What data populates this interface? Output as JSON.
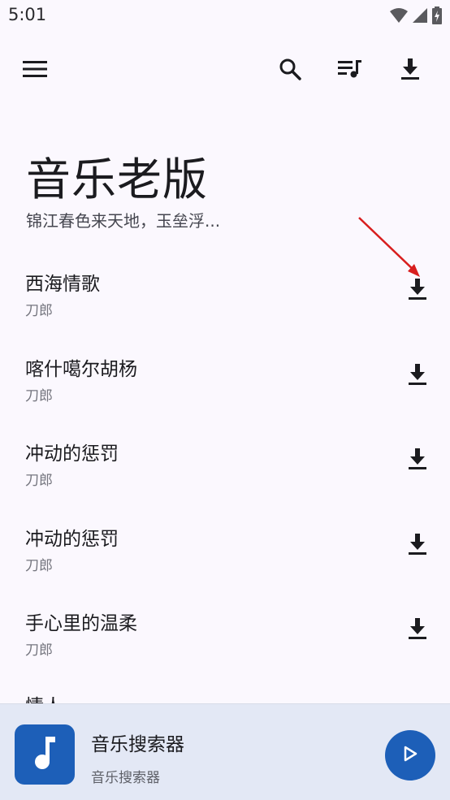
{
  "status_bar": {
    "time": "5:01",
    "icons": [
      "wifi-icon",
      "cell-signal-icon",
      "battery-charging-icon"
    ]
  },
  "toolbar": {
    "icons": [
      "menu-icon",
      "search-icon",
      "playlist-icon",
      "download-icon"
    ]
  },
  "header": {
    "title": "音乐老版",
    "subtitle": "锦江春色来天地，玉垒浮..."
  },
  "songs": [
    {
      "title": "西海情歌",
      "artist": "刀郎"
    },
    {
      "title": "喀什噶尔胡杨",
      "artist": "刀郎"
    },
    {
      "title": "冲动的惩罚",
      "artist": "刀郎"
    },
    {
      "title": "冲动的惩罚",
      "artist": "刀郎"
    },
    {
      "title": "手心里的温柔",
      "artist": "刀郎"
    }
  ],
  "partial_song": {
    "title": "情人"
  },
  "mini_player": {
    "title": "音乐搜索器",
    "subtitle": "音乐搜索器",
    "art_icon": "music-note-icon",
    "play_icon": "play-icon"
  },
  "colors": {
    "background": "#fbf8fe",
    "accent": "#1d5fb8",
    "player_bg": "#e3e8f5",
    "annotation_arrow": "#d81e1e"
  }
}
